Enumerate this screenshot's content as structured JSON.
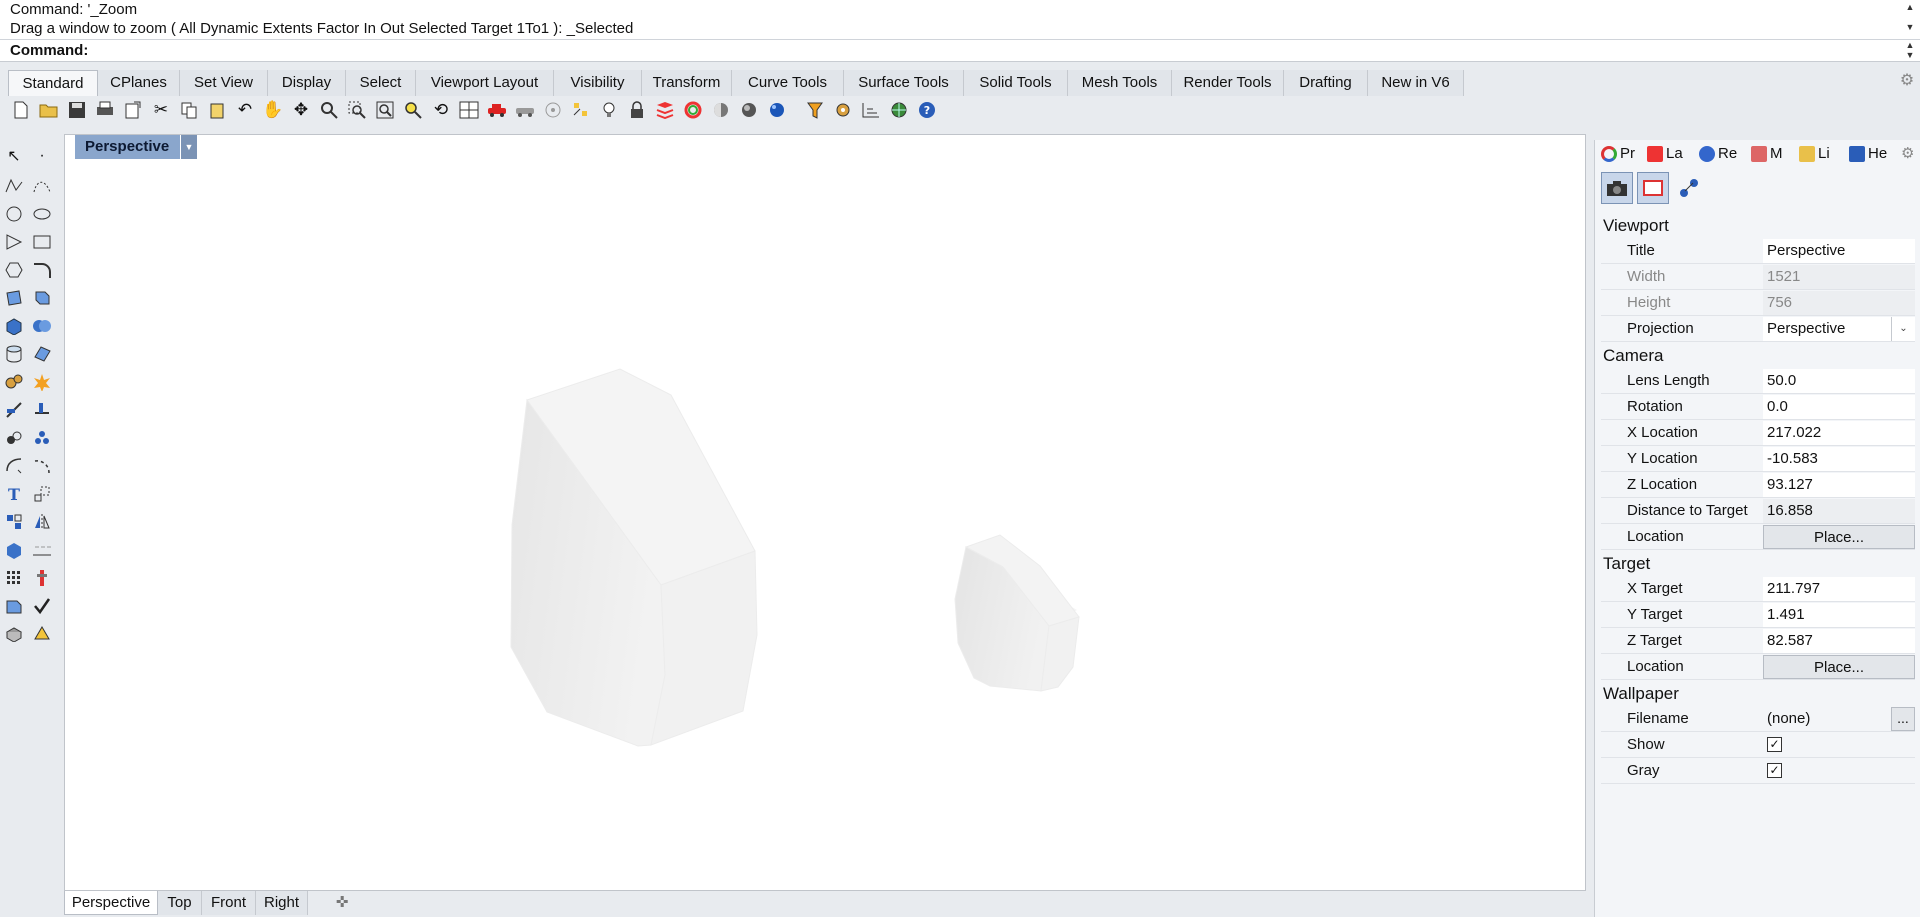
{
  "command_history": {
    "line1": "Command: '_Zoom",
    "line2": "Drag a window to zoom ( All  Dynamic  Extents  Factor  In  Out  Selected  Target  1To1 ): _Selected"
  },
  "command_prompt": {
    "label": "Command:",
    "value": ""
  },
  "toolbar_tabs": [
    "Standard",
    "CPlanes",
    "Set View",
    "Display",
    "Select",
    "Viewport Layout",
    "Visibility",
    "Transform",
    "Curve Tools",
    "Surface Tools",
    "Solid Tools",
    "Mesh Tools",
    "Render Tools",
    "Drafting",
    "New in V6"
  ],
  "active_toolbar_tab": "Standard",
  "viewport": {
    "title": "Perspective"
  },
  "viewport_tabs": [
    "Perspective",
    "Top",
    "Front",
    "Right"
  ],
  "active_viewport_tab": "Perspective",
  "panel_tabs": [
    "Pr",
    "La",
    "Re",
    "M",
    "Li",
    "He"
  ],
  "properties": {
    "viewport_section": "Viewport",
    "title_label": "Title",
    "title_value": "Perspective",
    "width_label": "Width",
    "width_value": "1521",
    "height_label": "Height",
    "height_value": "756",
    "projection_label": "Projection",
    "projection_value": "Perspective",
    "camera_section": "Camera",
    "lens_label": "Lens Length",
    "lens_value": "50.0",
    "rotation_label": "Rotation",
    "rotation_value": "0.0",
    "xloc_label": "X Location",
    "xloc_value": "217.022",
    "yloc_label": "Y Location",
    "yloc_value": "-10.583",
    "zloc_label": "Z Location",
    "zloc_value": "93.127",
    "dist_label": "Distance to Target",
    "dist_value": "16.858",
    "cam_location_label": "Location",
    "cam_location_button": "Place...",
    "target_section": "Target",
    "xtarget_label": "X Target",
    "xtarget_value": "211.797",
    "ytarget_label": "Y Target",
    "ytarget_value": "1.491",
    "ztarget_label": "Z Target",
    "ztarget_value": "82.587",
    "tgt_location_label": "Location",
    "tgt_location_button": "Place...",
    "wallpaper_section": "Wallpaper",
    "filename_label": "Filename",
    "filename_value": "(none)",
    "browse_button": "...",
    "show_label": "Show",
    "show_checked": true,
    "gray_label": "Gray",
    "gray_checked": true
  },
  "colors": {
    "viewport_title_bg": "#8aa6cc",
    "panel_button_bg": "#c8d6ea"
  }
}
